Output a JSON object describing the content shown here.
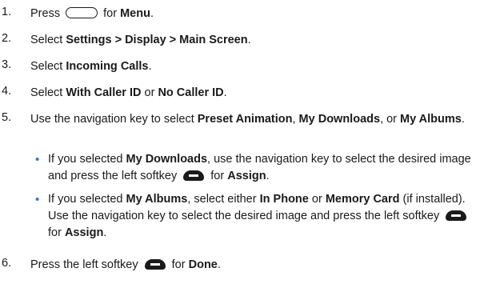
{
  "steps": [
    {
      "num": "1.",
      "pre": "Press",
      "icon": "menu-key-icon",
      "mid": "for",
      "bold": "Menu",
      "post": "."
    },
    {
      "num": "2.",
      "pre": "Select",
      "bold": "Settings > Display > Main Screen",
      "post": "."
    },
    {
      "num": "3.",
      "pre": "Select",
      "bold": "Incoming Calls",
      "post": "."
    },
    {
      "num": "4.",
      "pre": "Select",
      "bold1": "With Caller ID",
      "mid": "or",
      "bold2": "No Caller ID",
      "post": "."
    },
    {
      "num": "5.",
      "pre": "Use the navigation key to select",
      "bold1": "Preset Animation",
      "sep1": ",",
      "bold2": "My Downloads",
      "sep2": ", or",
      "bold3": "My Albums",
      "post": "."
    },
    {
      "num": "6.",
      "pre": "Press the left softkey",
      "icon": "softkey-icon",
      "mid": "for",
      "bold": "Done",
      "post": "."
    }
  ],
  "sub_items": [
    {
      "bullet": "•",
      "pre": "If you selected",
      "bold1": "My Downloads",
      "text1": ", use the navigation key to select the desired image and press the left softkey",
      "mid": "for",
      "bold2": "Assign",
      "post": "."
    },
    {
      "bullet": "•",
      "pre": "If you selected",
      "bold1": "My Albums",
      "text1": ", select either",
      "bold2": "In Phone",
      "text2": "or",
      "bold3": "Memory Card",
      "text3": "(if installed). Use the navigation key to select the desired image and press the left softkey",
      "mid": "for",
      "bold4": "Assign",
      "post": "."
    }
  ]
}
